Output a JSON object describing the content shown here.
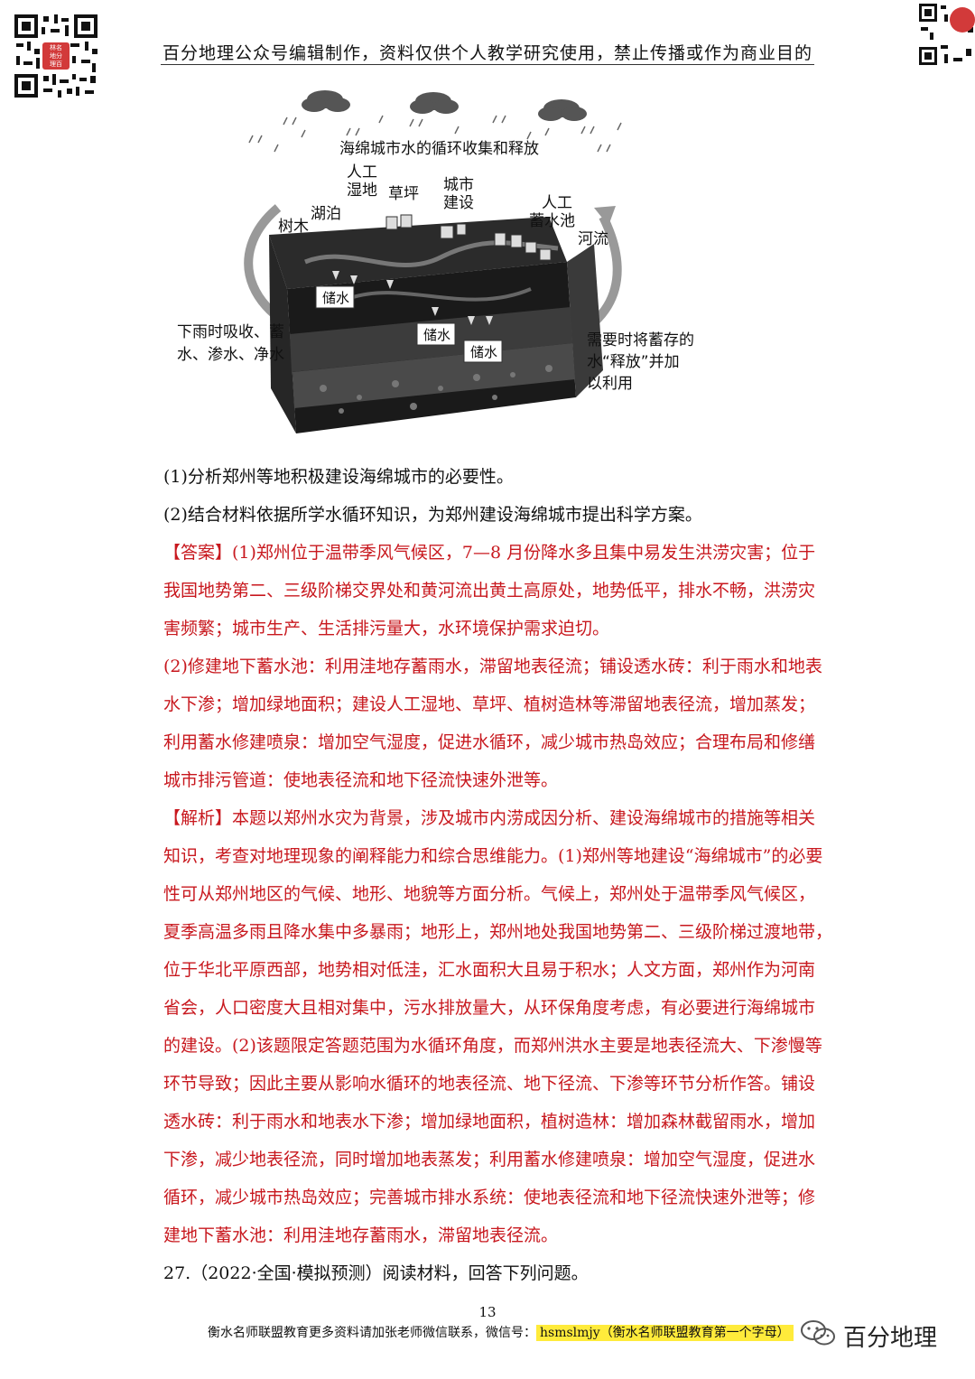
{
  "header": {
    "title": "百分地理公众号编辑制作，资料仅供个人教学研究使用，禁止传播或作为商业目的"
  },
  "qr_left": {
    "badge": [
      "林名",
      "地分",
      "理百"
    ]
  },
  "figure": {
    "title": "海绵城市水的循环收集和释放",
    "labels": {
      "wetland1": "人工",
      "wetland2": "湿地",
      "lawn": "草坪",
      "city1": "城市",
      "city2": "建设",
      "pool1": "人工",
      "pool2": "蓄水池",
      "tree": "树木",
      "lake": "湖泊",
      "river": "河流",
      "store1": "储水",
      "store2": "储水",
      "store3": "储水",
      "left1": "下雨时吸收、蓄",
      "left2": "水、渗水、净水",
      "right1": "需要时将蓄存的",
      "right2": "水“释放”并加",
      "right3": "以利用"
    }
  },
  "lines": [
    {
      "text": "(1)分析郑州等地积极建设海绵城市的必要性。",
      "color": "black"
    },
    {
      "text": "(2)结合材料依据所学水循环知识，为郑州建设海绵城市提出科学方案。",
      "color": "black"
    },
    {
      "text": "【答案】(1)郑州位于温带季风气候区，7—8 月份降水多且集中易发生洪涝灾害；位于",
      "color": "red"
    },
    {
      "text": "我国地势第二、三级阶梯交界处和黄河流出黄土高原处，地势低平，排水不畅，洪涝灾",
      "color": "red"
    },
    {
      "text": "害频繁；城市生产、生活排污量大，水环境保护需求迫切。",
      "color": "red"
    },
    {
      "text": "(2)修建地下蓄水池：利用洼地存蓄雨水，滞留地表径流；铺设透水砖：利于雨水和地表",
      "color": "red"
    },
    {
      "text": "水下渗；增加绿地面积；建设人工湿地、草坪、植树造林等滞留地表径流，增加蒸发；",
      "color": "red"
    },
    {
      "text": "利用蓄水修建喷泉：增加空气湿度，促进水循环，减少城市热岛效应；合理布局和修缮",
      "color": "red"
    },
    {
      "text": "城市排污管道：使地表径流和地下径流快速外泄等。",
      "color": "red"
    },
    {
      "text": "【解析】本题以郑州水灾为背景，涉及城市内涝成因分析、建设海绵城市的措施等相关",
      "color": "red"
    },
    {
      "text": "知识，考查对地理现象的阐释能力和综合思维能力。(1)郑州等地建设“海绵城市”的必要",
      "color": "red"
    },
    {
      "text": "性可从郑州地区的气候、地形、地貌等方面分析。气候上，郑州处于温带季风气候区，",
      "color": "red"
    },
    {
      "text": "夏季高温多雨且降水集中多暴雨；地形上，郑州地处我国地势第二、三级阶梯过渡地带，",
      "color": "red"
    },
    {
      "text": "位于华北平原西部，地势相对低洼，汇水面积大且易于积水；人文方面，郑州作为河南",
      "color": "red"
    },
    {
      "text": "省会，人口密度大且相对集中，污水排放量大，从环保角度考虑，有必要进行海绵城市",
      "color": "red"
    },
    {
      "text": "的建设。(2)该题限定答题范围为水循环角度，而郑州洪水主要是地表径流大、下渗慢等",
      "color": "red"
    },
    {
      "text": "环节导致；因此主要从影响水循环的地表径流、地下径流、下渗等环节分析作答。铺设",
      "color": "red"
    },
    {
      "text": "透水砖：利于雨水和地表水下渗；增加绿地面积，植树造林：增加森林截留雨水，增加",
      "color": "red"
    },
    {
      "text": "下渗，减少地表径流，同时增加地表蒸发；利用蓄水修建喷泉：增加空气湿度，促进水",
      "color": "red"
    },
    {
      "text": "循环，减少城市热岛效应；完善城市排水系统：使地表径流和地下径流快速外泄等；修",
      "color": "red"
    },
    {
      "text": "建地下蓄水池：利用洼地存蓄雨水，滞留地表径流。",
      "color": "red"
    },
    {
      "text": "27.（2022·全国·模拟预测）阅读材料，回答下列问题。",
      "color": "black"
    }
  ],
  "footer": {
    "page_number": "13",
    "text": "衡水名师联盟教育更多资料请加张老师微信联系，微信号：",
    "highlight": "hsmslmjy（衡水名师联盟教育第一个字母）",
    "wechat_name": "百分地理"
  }
}
